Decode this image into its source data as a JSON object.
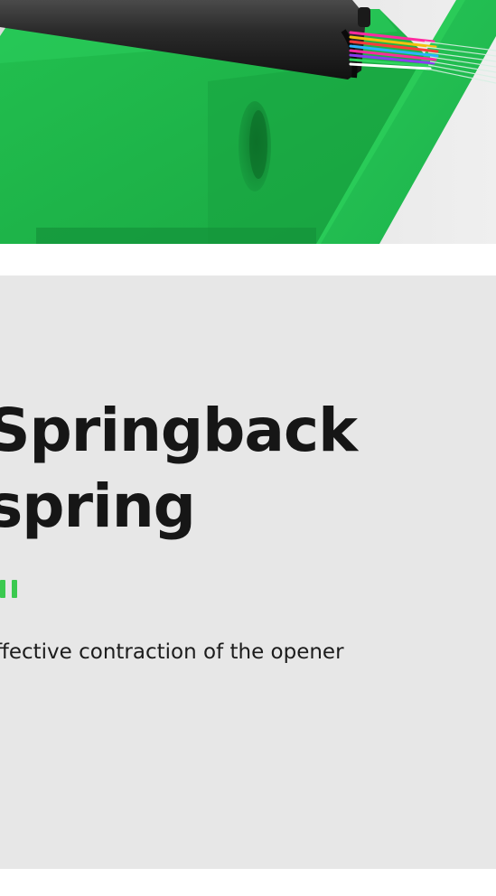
{
  "feature": {
    "title_line_1": "Springback",
    "title_line_2": "spring",
    "description": "ffective contraction of the opener",
    "accent_color": "#3bc94f"
  },
  "photo": {
    "subject": "green fiber cable opener with multicolored fiber strands",
    "body_color": "#1fb84a",
    "background_color": "#e6e6e6"
  },
  "panel": {
    "background_color": "#e7e7e7"
  }
}
